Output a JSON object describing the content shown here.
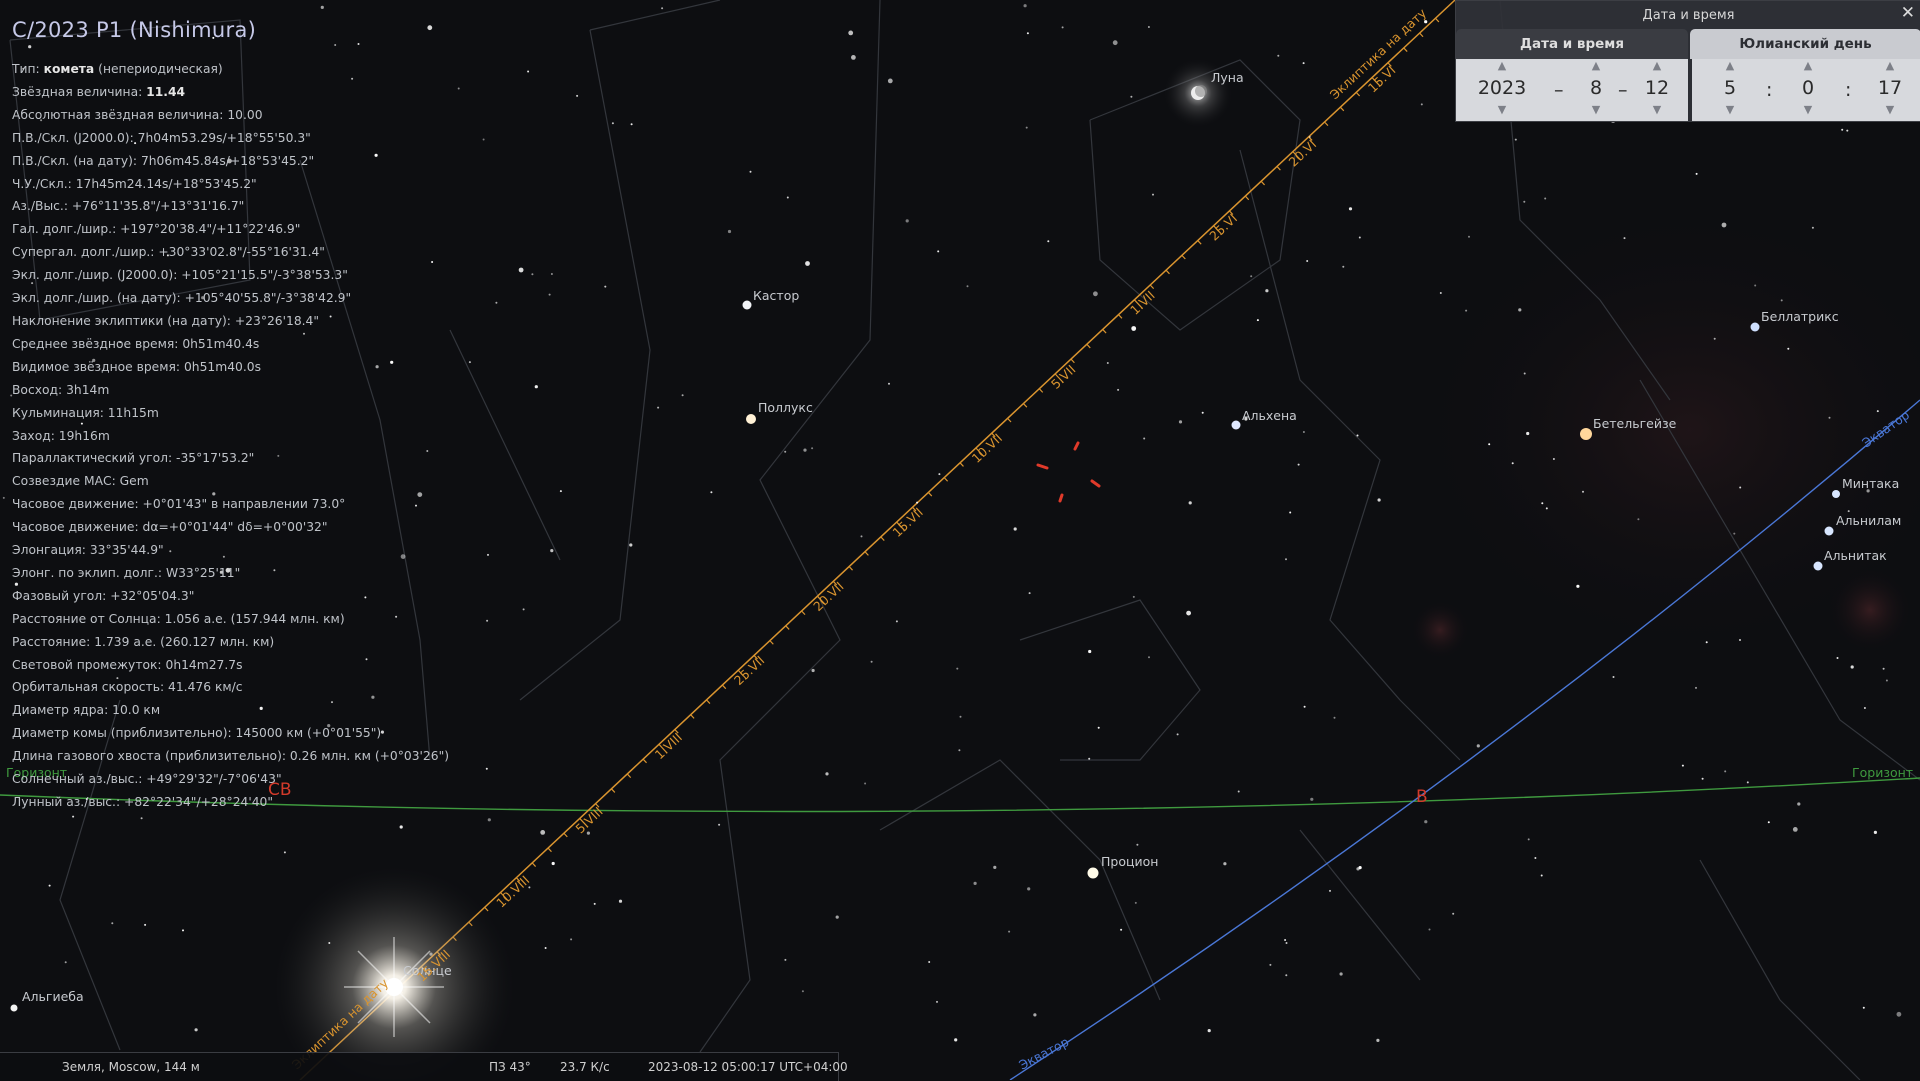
{
  "object": {
    "title": "C/2023 P1 (Nishimura)",
    "lines": [
      {
        "label": "Тип: ",
        "bold": "комета",
        "rest": " (непериодическая)"
      },
      {
        "label": "Звёздная величина: ",
        "bold": "11.44",
        "rest": ""
      },
      {
        "label": "Абсолютная звёздная величина: 10.00",
        "bold": "",
        "rest": ""
      },
      {
        "label": "П.В./Скл. (J2000.0): 7h04m53.29s/+18°55'50.3\"",
        "bold": "",
        "rest": ""
      },
      {
        "label": "П.В./Скл. (на дату): 7h06m45.84s/+18°53'45.2\"",
        "bold": "",
        "rest": ""
      },
      {
        "label": "Ч.У./Скл.: 17h45m24.14s/+18°53'45.2\"",
        "bold": "",
        "rest": ""
      },
      {
        "label": "Аз./Выс.: +76°11'35.8\"/+13°31'16.7\"",
        "bold": "",
        "rest": ""
      },
      {
        "label": "Гал. долг./шир.: +197°20'38.4\"/+11°22'46.9\"",
        "bold": "",
        "rest": ""
      },
      {
        "label": "Супергал. долг./шир.: +30°33'02.8\"/-55°16'31.4\"",
        "bold": "",
        "rest": ""
      },
      {
        "label": "Экл. долг./шир. (J2000.0): +105°21'15.5\"/-3°38'53.3\"",
        "bold": "",
        "rest": ""
      },
      {
        "label": "Экл. долг./шир. (на дату): +105°40'55.8\"/-3°38'42.9\"",
        "bold": "",
        "rest": ""
      },
      {
        "label": "Наклонение эклиптики (на дату): +23°26'18.4\"",
        "bold": "",
        "rest": ""
      },
      {
        "label": "Среднее звёздное время: 0h51m40.4s",
        "bold": "",
        "rest": ""
      },
      {
        "label": "Видимое звёздное время: 0h51m40.0s",
        "bold": "",
        "rest": ""
      },
      {
        "label": "Восход: 3h14m",
        "bold": "",
        "rest": ""
      },
      {
        "label": "Кульминация: 11h15m",
        "bold": "",
        "rest": ""
      },
      {
        "label": "Заход: 19h16m",
        "bold": "",
        "rest": ""
      },
      {
        "label": "Параллактический угол: -35°17'53.2\"",
        "bold": "",
        "rest": ""
      },
      {
        "label": "Созвездие МАС: Gem",
        "bold": "",
        "rest": ""
      },
      {
        "label": "Часовое движение: +0°01'43\" в направлении 73.0°",
        "bold": "",
        "rest": ""
      },
      {
        "label": "Часовое движение: dα=+0°01'44\" dδ=+0°00'32\"",
        "bold": "",
        "rest": ""
      },
      {
        "label": "Элонгация: 33°35'44.9\"",
        "bold": "",
        "rest": ""
      },
      {
        "label": "Элонг. по эклип. долг.: W33°25'11\"",
        "bold": "",
        "rest": ""
      },
      {
        "label": "Фазовый угол: +32°05'04.3\"",
        "bold": "",
        "rest": ""
      },
      {
        "label": "Расстояние от Солнца: 1.056 а.е. (157.944 млн. км)",
        "bold": "",
        "rest": ""
      },
      {
        "label": "Расстояние: 1.739 а.е. (260.127 млн. км)",
        "bold": "",
        "rest": ""
      },
      {
        "label": "Световой промежуток: 0h14m27.7s",
        "bold": "",
        "rest": ""
      },
      {
        "label": "Орбитальная скорость: 41.476 км/с",
        "bold": "",
        "rest": ""
      },
      {
        "label": "Диаметр ядра: 10.0 км",
        "bold": "",
        "rest": ""
      },
      {
        "label": "Диаметр комы (приблизительно): 145000 км (+0°01'55\")",
        "bold": "",
        "rest": ""
      },
      {
        "label": "Длина газового хвоста (приблизительно): 0.26 млн. км (+0°03'26\")",
        "bold": "",
        "rest": ""
      },
      {
        "label": "Солнечный аз./выс.: +49°29'32\"/-7°06'43\"",
        "bold": "",
        "rest": ""
      },
      {
        "label": "Лунный аз./выс.: +82°22'34\"/+28°24'40\"",
        "bold": "",
        "rest": ""
      }
    ]
  },
  "sky_labels": {
    "stars": [
      "Кастор",
      "Поллукс",
      "Альхена",
      "Бетельгейзе",
      "Беллатрикс",
      "Минтака",
      "Альнилам",
      "Альнитак",
      "Процион",
      "Альгиеба"
    ],
    "sun": "Солнце",
    "moon": "Луна",
    "horizon_left": "Горизонт",
    "horizon_right": "Горизонт",
    "equator_upper": "Экватор",
    "equator_lower": "Экватор",
    "ecliptic_upper": "Эклиптика на дату",
    "ecliptic_lower": "Эклиптика на дату",
    "cardinal_ne": "СВ",
    "cardinal_e": "В",
    "ecliptic_ticks": [
      "15.VIII",
      "10.VIII",
      "5.VIII",
      "1.VIII",
      "25.VII",
      "20.VII",
      "15.VII",
      "10.VII",
      "5.VII",
      "1.VII",
      "25.VI",
      "20.VI",
      "15.VI"
    ]
  },
  "datetime_panel": {
    "title": "Дата и время",
    "close": "✕",
    "tab_date": "Дата и время",
    "tab_julian": "Юлианский день",
    "year": "2023",
    "month": "8",
    "day": "12",
    "hour": "5",
    "minute": "0",
    "second": "17",
    "date_sep": "–",
    "time_sep": ":"
  },
  "status_bar": {
    "location": "Земля, Moscow, 144 м",
    "fov": "ПЗ 43°",
    "fps": "23.7 К/с",
    "datetime": "2023-08-12 05:00:17 UTC+04:00"
  },
  "colors": {
    "horizon": "#3f9a3f",
    "equator": "#4a77d6",
    "ecliptic": "#d9942f",
    "cardinal": "#d23a2a",
    "constellation": "#3a3d44",
    "star_label": "#c8cbd0"
  }
}
